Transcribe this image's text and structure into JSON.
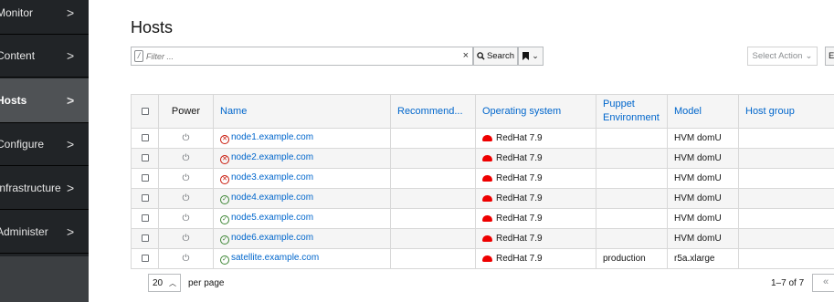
{
  "sidebar": {
    "items": [
      {
        "label": "Monitor",
        "active": false
      },
      {
        "label": "Content",
        "active": false
      },
      {
        "label": "Hosts",
        "active": true
      },
      {
        "label": "Configure",
        "active": false
      },
      {
        "label": "Infrastructure",
        "active": false
      },
      {
        "label": "Administer",
        "active": false
      }
    ],
    "chevron": ">"
  },
  "page": {
    "title": "Hosts"
  },
  "search": {
    "placeholder": "Filter ...",
    "clear_icon": "×",
    "search_label": "Search",
    "bookmark_caret": "⌄"
  },
  "actions": {
    "select_action_label": "Select Action",
    "export_label": "Export"
  },
  "table": {
    "columns": [
      "Power",
      "Name",
      "Recommend...",
      "Operating system",
      "Puppet Environment",
      "Model",
      "Host group"
    ],
    "rows": [
      {
        "status": "error",
        "name": "node1.example.com",
        "recommend": "",
        "os": "RedHat 7.9",
        "puppet_env": "",
        "model": "HVM domU",
        "host_group": ""
      },
      {
        "status": "error",
        "name": "node2.example.com",
        "recommend": "",
        "os": "RedHat 7.9",
        "puppet_env": "",
        "model": "HVM domU",
        "host_group": ""
      },
      {
        "status": "error",
        "name": "node3.example.com",
        "recommend": "",
        "os": "RedHat 7.9",
        "puppet_env": "",
        "model": "HVM domU",
        "host_group": ""
      },
      {
        "status": "ok",
        "name": "node4.example.com",
        "recommend": "",
        "os": "RedHat 7.9",
        "puppet_env": "",
        "model": "HVM domU",
        "host_group": ""
      },
      {
        "status": "ok",
        "name": "node5.example.com",
        "recommend": "",
        "os": "RedHat 7.9",
        "puppet_env": "",
        "model": "HVM domU",
        "host_group": ""
      },
      {
        "status": "ok",
        "name": "node6.example.com",
        "recommend": "",
        "os": "RedHat 7.9",
        "puppet_env": "",
        "model": "HVM domU",
        "host_group": ""
      },
      {
        "status": "ok",
        "name": "satellite.example.com",
        "recommend": "",
        "os": "RedHat 7.9",
        "puppet_env": "production",
        "model": "r5a.xlarge",
        "host_group": ""
      }
    ]
  },
  "pagination": {
    "per_page_value": "20",
    "per_page_label": "per page",
    "range": "1–7 of  7",
    "first_icon": "«"
  },
  "colors": {
    "link": "#0066cc",
    "error": "#c9190b",
    "success": "#3e8635",
    "redhat": "#ee0000",
    "sidebar_bg": "#212427",
    "sidebar_active": "#4f5255"
  }
}
